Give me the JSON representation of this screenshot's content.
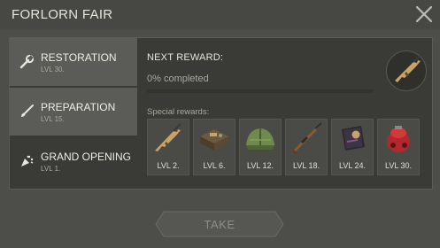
{
  "window": {
    "title": "FORLORN FAIR"
  },
  "tabs": [
    {
      "name": "RESTORATION",
      "level": "LVL 30.",
      "icon": "wrench-icon"
    },
    {
      "name": "PREPARATION",
      "level": "LVL 15.",
      "icon": "paintbrush-icon"
    },
    {
      "name": "GRAND OPENING",
      "level": "LVL 1.",
      "icon": "party-popper-icon"
    }
  ],
  "next_reward": {
    "label": "NEXT REWARD:",
    "progress_text": "0% completed",
    "progress_fraction": 0,
    "icon": "rifle-icon"
  },
  "special_rewards": {
    "label": "Special rewards:",
    "items": [
      {
        "level": "LVL 2.",
        "icon": "rifle-icon"
      },
      {
        "level": "LVL 6.",
        "icon": "workbench-icon"
      },
      {
        "level": "LVL 12.",
        "icon": "tent-icon"
      },
      {
        "level": "LVL 18.",
        "icon": "sniper-rifle-icon"
      },
      {
        "level": "LVL 24.",
        "icon": "badge-book-icon"
      },
      {
        "level": "LVL 30.",
        "icon": "red-backpack-icon"
      }
    ]
  },
  "take_button": {
    "label": "TAKE",
    "state": "disabled"
  }
}
